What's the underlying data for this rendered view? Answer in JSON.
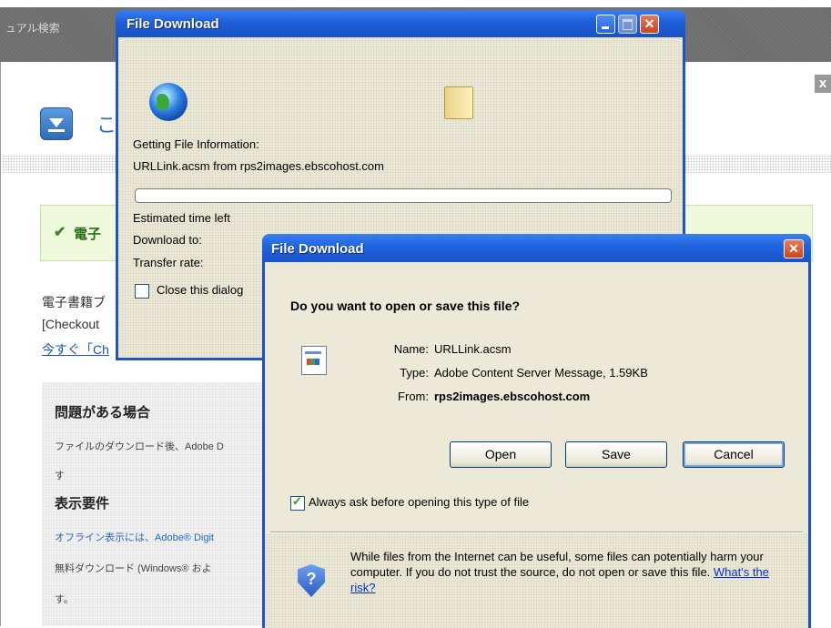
{
  "background_page": {
    "topbar_label": "ュアル検索",
    "close_glyph": "x",
    "title_fragment": "こ",
    "success_fragment": "電子",
    "line1": "電子書籍ブ",
    "line2": "[Checkout",
    "line3": "今すぐ「Ch",
    "help": {
      "heading1": "問題がある場合",
      "text1": "ファイルのダウンロード後、Adobe D",
      "text2": "す",
      "heading2": "表示要件",
      "text3": "オフライン表示には、Adobe® Digit",
      "text4": "無料ダウンロード (Windows® およ",
      "text5": "す。"
    }
  },
  "progress_dialog": {
    "title": "File Download",
    "getting_info": "Getting File Information:",
    "file_line": "URLLink.acsm from rps2images.ebscohost.com",
    "estimated_time": "Estimated time left",
    "download_to": "Download to:",
    "transfer_rate": "Transfer rate:",
    "close_checkbox": "Close this dialog",
    "progress": 0,
    "icons": {
      "source": "globe-icon",
      "target": "folder-icon"
    }
  },
  "main_dialog": {
    "title": "File Download",
    "question": "Do you want to open or save this file?",
    "name_label": "Name:",
    "name_value": "URLLink.acsm",
    "type_label": "Type:",
    "type_value": "Adobe Content Server Message, 1.59KB",
    "from_label": "From:",
    "from_value": "rps2images.ebscohost.com",
    "buttons": {
      "open": "Open",
      "save": "Save",
      "cancel": "Cancel"
    },
    "always_ask": "Always ask before opening this type of file",
    "always_ask_checked": true,
    "warning_text": "While files from the Internet can be useful, some files can potentially harm your computer. If you do not trust the source, do not open or save this file. ",
    "warning_link": "What's the risk?"
  },
  "colors": {
    "titlebar": "#1f62e0",
    "dialog_bg": "#ece9d8",
    "close_red": "#c9441c"
  }
}
